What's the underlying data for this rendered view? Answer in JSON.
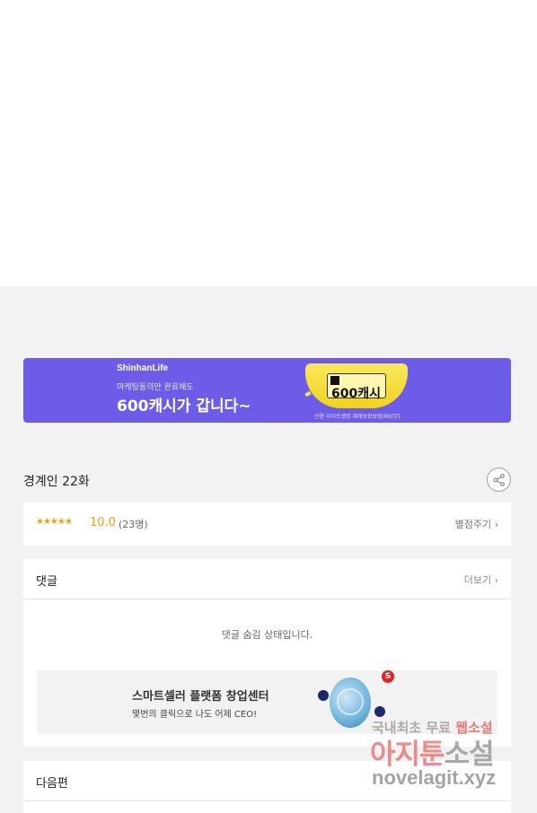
{
  "banner": {
    "brand": "ShinhanLife",
    "sub": "마케팅동의만 완료해도",
    "headline": "600캐시가 갑니다~",
    "coupon_text": "600캐시",
    "fine_print": "신한 라이프생명 재해보장보험(M)(무)"
  },
  "episode": {
    "title": "경계인 22화"
  },
  "rating": {
    "stars": "★★★★★",
    "score": "10.0",
    "count": "(23명)",
    "rate_link": "별점주기 ›"
  },
  "comments": {
    "title": "댓글",
    "more_link": "더보기 ›",
    "hidden_message": "댓글 숨김 상태입니다."
  },
  "ad": {
    "title": "스마트셀러 플랫폼 창업센터",
    "subtitle": "몇번의 클릭으로 나도 어제 CEO!",
    "logo_letter": "S"
  },
  "next": {
    "title": "다음편"
  },
  "watermark": {
    "line1_a": "국내최초 무료 ",
    "line1_b": "웹소설",
    "line2_a": "아지툰",
    "line2_b": "소설",
    "line3": "novelagit.xyz"
  },
  "colors": {
    "banner_bg": "#6c5ce7",
    "star": "#f39c12",
    "page_bg": "#f2f2f2"
  }
}
